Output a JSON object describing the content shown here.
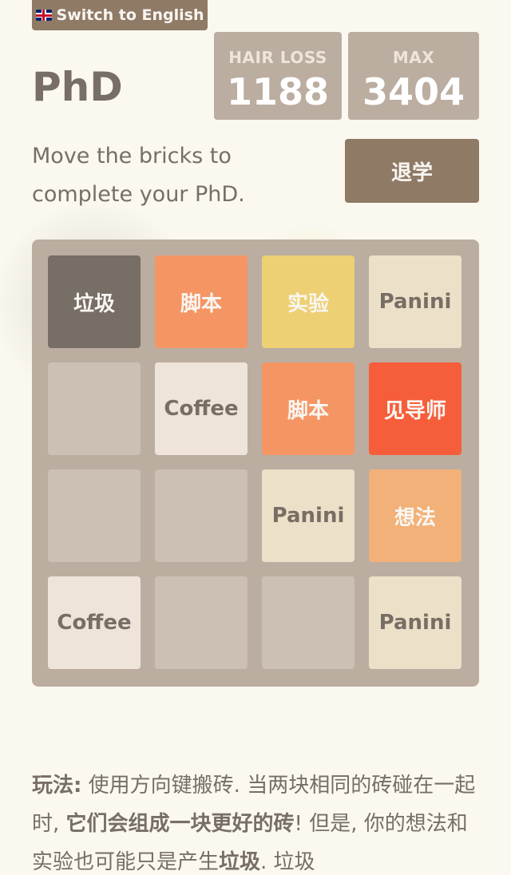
{
  "header": {
    "lang_button": "Switch to English",
    "title": "PhD",
    "intro": "Move the bricks to complete your PhD.",
    "quit_button": "退学"
  },
  "scores": {
    "hair_loss_label": "HAIR LOSS",
    "hair_loss_value": "1188",
    "max_label": "MAX",
    "max_value": "3404"
  },
  "board": {
    "size": 4,
    "tiles": [
      {
        "row": 0,
        "col": 0,
        "label": "垃圾",
        "bg": "#776e65",
        "fg": "#f9f6f2"
      },
      {
        "row": 0,
        "col": 1,
        "label": "脚本",
        "bg": "#f59563",
        "fg": "#f9f6f2"
      },
      {
        "row": 0,
        "col": 2,
        "label": "实验",
        "bg": "#edd073",
        "fg": "#f9f6f2"
      },
      {
        "row": 0,
        "col": 3,
        "label": "Panini",
        "bg": "#ede0c8",
        "fg": "#776e65"
      },
      {
        "row": 1,
        "col": 1,
        "label": "Coffee",
        "bg": "#eee4da",
        "fg": "#776e65"
      },
      {
        "row": 1,
        "col": 2,
        "label": "脚本",
        "bg": "#f59563",
        "fg": "#f9f6f2"
      },
      {
        "row": 1,
        "col": 3,
        "label": "见导师",
        "bg": "#f65e3b",
        "fg": "#f9f6f2"
      },
      {
        "row": 2,
        "col": 2,
        "label": "Panini",
        "bg": "#ede0c8",
        "fg": "#776e65"
      },
      {
        "row": 2,
        "col": 3,
        "label": "想法",
        "bg": "#f2b179",
        "fg": "#f9f6f2"
      },
      {
        "row": 3,
        "col": 0,
        "label": "Coffee",
        "bg": "#eee4da",
        "fg": "#776e65"
      },
      {
        "row": 3,
        "col": 3,
        "label": "Panini",
        "bg": "#ede0c8",
        "fg": "#776e65"
      }
    ]
  },
  "instructions": {
    "label": "玩法:",
    "part1": " 使用方向键搬砖. 当两块相同的砖碰在一起时, ",
    "bold1": "它们会组成一块更好的砖",
    "part2": "! 但是, 你的想法和实验也可能只是产生",
    "bold2": "垃圾",
    "part3": ". 垃圾"
  },
  "colors": {
    "background": "#faf8ef",
    "board": "#bbada0",
    "button": "#8f7a66",
    "text": "#776e65"
  }
}
